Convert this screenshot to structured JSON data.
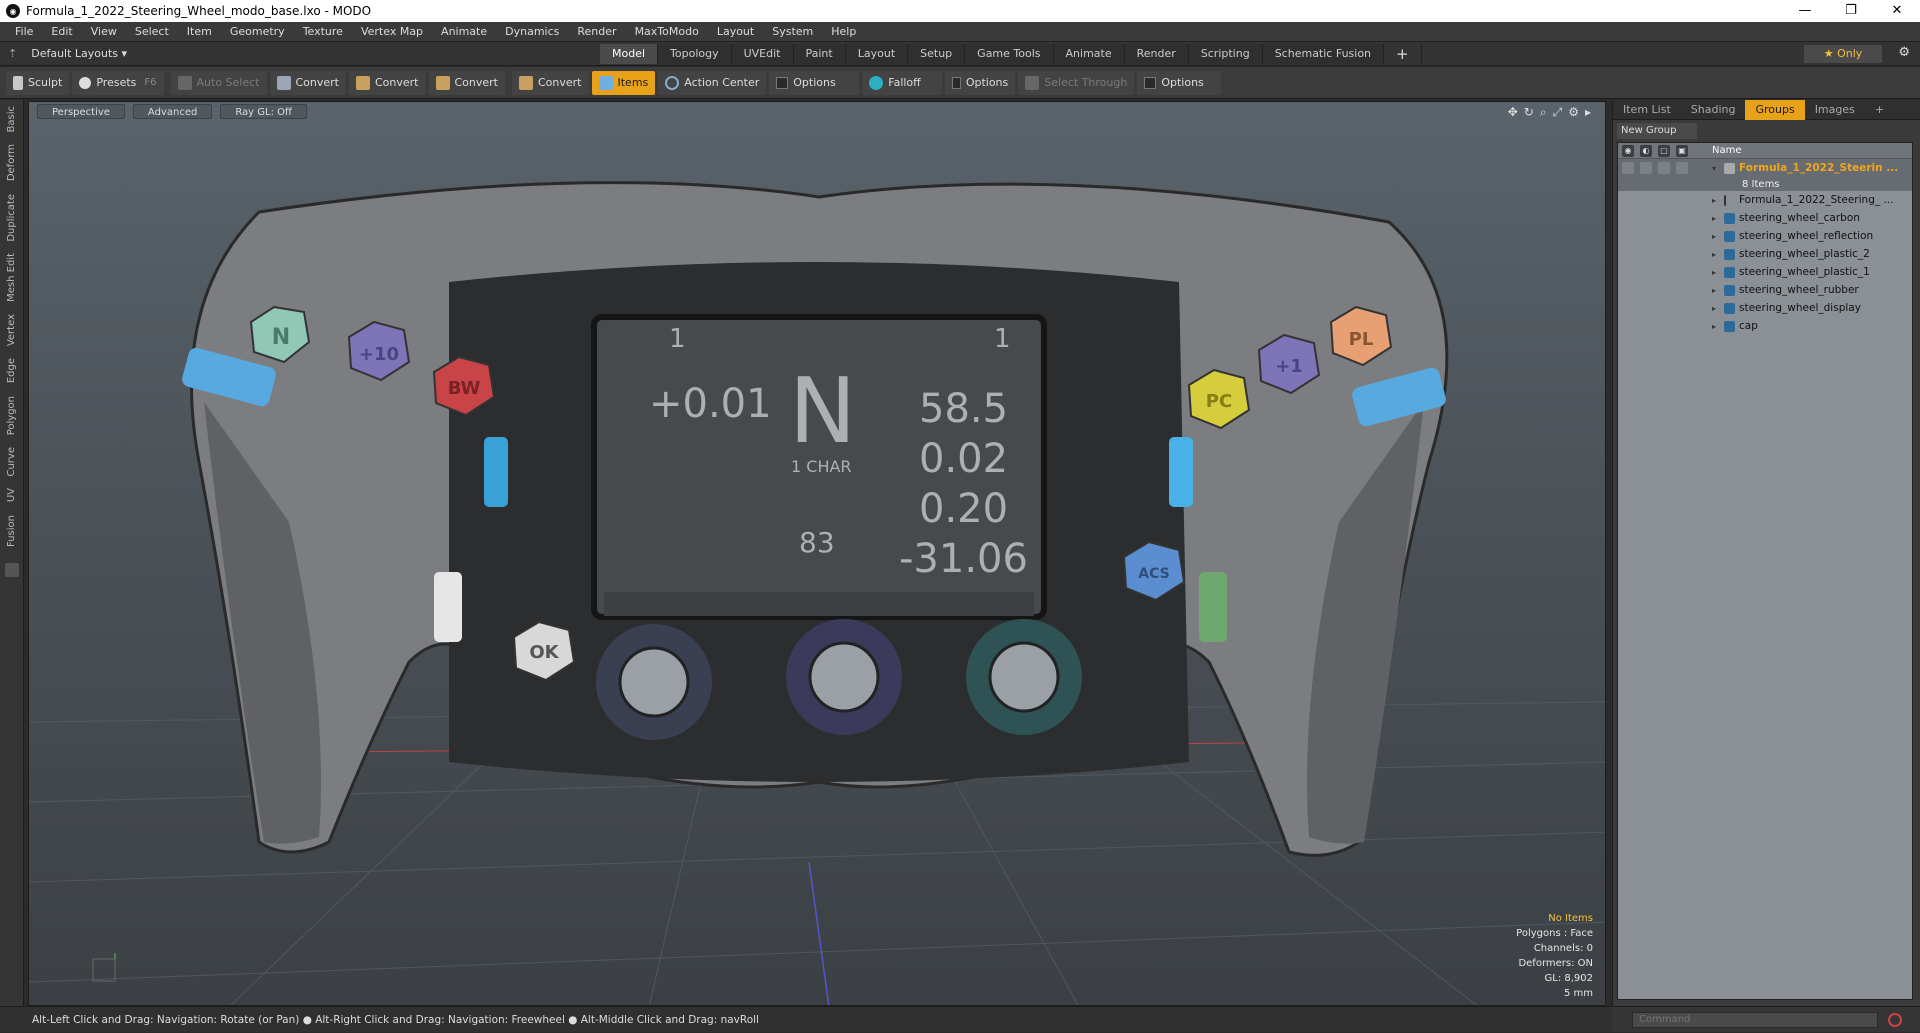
{
  "window": {
    "title": "Formula_1_2022_Steering_Wheel_modo_base.lxo - MODO",
    "min": "—",
    "max": "❐",
    "close": "✕"
  },
  "menu": [
    "File",
    "Edit",
    "View",
    "Select",
    "Item",
    "Geometry",
    "Texture",
    "Vertex Map",
    "Animate",
    "Dynamics",
    "Render",
    "MaxToModo",
    "Layout",
    "System",
    "Help"
  ],
  "layout": {
    "label": "Default Layouts ▾"
  },
  "tabs": [
    {
      "label": "Model",
      "active": true
    },
    {
      "label": "Topology"
    },
    {
      "label": "UVEdit"
    },
    {
      "label": "Paint"
    },
    {
      "label": "Layout"
    },
    {
      "label": "Setup"
    },
    {
      "label": "Game Tools"
    },
    {
      "label": "Animate"
    },
    {
      "label": "Render"
    },
    {
      "label": "Scripting"
    },
    {
      "label": "Schematic Fusion"
    }
  ],
  "only_label": "★  Only",
  "toolbar": {
    "sculpt": "Sculpt",
    "presets": "Presets",
    "presets_key": "F6",
    "auto_select": "Auto Select",
    "convert1": "Convert",
    "convert2": "Convert",
    "convert3": "Convert",
    "convert4": "Convert",
    "items": "Items",
    "action_center": "Action Center",
    "options1": "Options",
    "falloff": "Falloff",
    "options2": "Options",
    "select_through": "Select Through",
    "options3": "Options"
  },
  "left_tabs": [
    "Basic",
    "Deform",
    "Duplicate",
    "Mesh Edit",
    "Vertex",
    "Edge",
    "Polygon",
    "Curve",
    "UV",
    "Fusion"
  ],
  "viewport": {
    "perspective": "Perspective",
    "advanced": "Advanced",
    "raygl": "Ray GL: Off",
    "hud": {
      "no_items": "No Items",
      "polygons": "Polygons : Face",
      "channels": "Channels: 0",
      "deformers": "Deformers: ON",
      "gl": "GL: 8,902",
      "scale": "5 mm"
    },
    "display": {
      "gap": "+0.01",
      "gear": "N",
      "speed": "58.5",
      "v2": "0.02",
      "v3": "0.20",
      "v4": "-31.06",
      "lap": "83",
      "top1": "1",
      "top2": "1",
      "char": "1 CHAR"
    },
    "buttons": {
      "n": "N",
      "p10": "+10",
      "bw": "BW",
      "pc": "PC",
      "p1": "+1",
      "pl": "PL",
      "ok": "OK",
      "acs": "ACS"
    }
  },
  "right_panel": {
    "tabs": [
      {
        "label": "Item List"
      },
      {
        "label": "Shading"
      },
      {
        "label": "Groups",
        "active": true
      },
      {
        "label": "Images"
      },
      {
        "label": "+"
      }
    ],
    "new_group": "New Group",
    "name_header": "Name",
    "group": {
      "name": "Formula_1_2022_Steerin ...",
      "count": "8 Items"
    },
    "items": [
      "Formula_1_2022_Steering_ ...",
      "steering_wheel_carbon",
      "steering_wheel_reflection",
      "steering_wheel_plastic_2",
      "steering_wheel_plastic_1",
      "steering_wheel_rubber",
      "steering_wheel_display",
      "cap"
    ]
  },
  "command": {
    "placeholder": "Command"
  },
  "status": "Alt-Left Click and Drag: Navigation: Rotate (or Pan) ● Alt-Right Click and Drag: Navigation: Freewheel ● Alt-Middle Click and Drag: navRoll"
}
